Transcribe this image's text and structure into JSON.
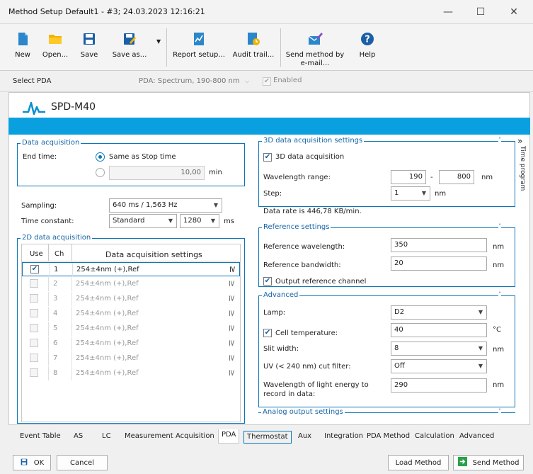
{
  "window": {
    "title": "Method Setup Default1 - #3;  24.03.2023  12:16:21",
    "minimize": "—",
    "maximize": "☐",
    "close": "✕"
  },
  "toolbar": {
    "new": "New",
    "open": "Open...",
    "save": "Save",
    "save_as": "Save as...",
    "report_setup": "Report setup...",
    "audit_trail": "Audit trail...",
    "send_method_l1": "Send method by",
    "send_method_l2": "e-mail...",
    "help": "Help"
  },
  "select_pda": {
    "label": "Select PDA",
    "value": "PDA: Spectrum, 190-800 nm",
    "enabled_label": "Enabled"
  },
  "device": {
    "name": "SPD-M40"
  },
  "data_acquisition": {
    "title": "Data acquisition",
    "end_time_label": "End  time:",
    "same_as_stop": "Same as Stop time",
    "end_time_value": "10,00",
    "unit_min": "min"
  },
  "sampling": {
    "label": "Sampling:",
    "value": "640 ms /  1,563 Hz"
  },
  "time_constant": {
    "label": "Time constant:",
    "value": "Standard",
    "ms_value": "1280",
    "unit": "ms"
  },
  "acq2d": {
    "title": "2D data acquisition",
    "col_use": "Use",
    "col_ch": "Ch",
    "col_settings": "Data acquisition settings",
    "rows": [
      {
        "ch": "1",
        "settings": "254±4nm (+),Ref",
        "checked": "✔"
      },
      {
        "ch": "2",
        "settings": "254±4nm (+),Ref",
        "checked": ""
      },
      {
        "ch": "3",
        "settings": "254±4nm (+),Ref",
        "checked": ""
      },
      {
        "ch": "4",
        "settings": "254±4nm (+),Ref",
        "checked": ""
      },
      {
        "ch": "5",
        "settings": "254±4nm (+),Ref",
        "checked": ""
      },
      {
        "ch": "6",
        "settings": "254±4nm (+),Ref",
        "checked": ""
      },
      {
        "ch": "7",
        "settings": "254±4nm (+),Ref",
        "checked": ""
      },
      {
        "ch": "8",
        "settings": "254±4nm (+),Ref",
        "checked": ""
      }
    ],
    "expand_glyph": "≥"
  },
  "acq3d": {
    "title": "3D data acquisition settings",
    "enable_label": "3D data acquisition",
    "wl_label": "Wavelength range:",
    "wl_from": "190",
    "wl_dash": "-",
    "wl_to": "800",
    "wl_unit": "nm",
    "step_label": "Step:",
    "step_value": "1",
    "step_unit": "nm",
    "data_rate": "Data rate is 446,78 KB/min."
  },
  "reference": {
    "title": "Reference settings",
    "wl_label": "Reference wavelength:",
    "wl_value": "350",
    "bw_label": "Reference bandwidth:",
    "bw_value": "20",
    "unit": "nm",
    "output_label": "Output reference channel"
  },
  "advanced": {
    "title": "Advanced",
    "lamp_label": "Lamp:",
    "lamp_value": "D2",
    "cell_label": "Cell temperature:",
    "cell_value": "40",
    "cell_unit": "°C",
    "slit_label": "Slit width:",
    "slit_value": "8",
    "slit_unit": "nm",
    "uv_label": "UV (< 240 nm) cut filter:",
    "uv_value": "Off",
    "light_label_1": "Wavelength of light energy to",
    "light_label_2": "record in data:",
    "light_value": "290",
    "light_unit": "nm"
  },
  "analog": {
    "title": "Analog output settings"
  },
  "side_tab": {
    "label": "Time program",
    "glyph": "»"
  },
  "collapse_glyph": "˄",
  "expand_small_glyph": "˅",
  "tabs": [
    "Event Table",
    "AS",
    "LC",
    "Measurement",
    "Acquisition",
    "PDA",
    "Thermostat",
    "Aux",
    "Integration",
    "PDA Method",
    "Calculation",
    "Advanced"
  ],
  "buttons": {
    "ok": "OK",
    "cancel": "Cancel",
    "load_method": "Load Method",
    "send_method": "Send Method"
  }
}
